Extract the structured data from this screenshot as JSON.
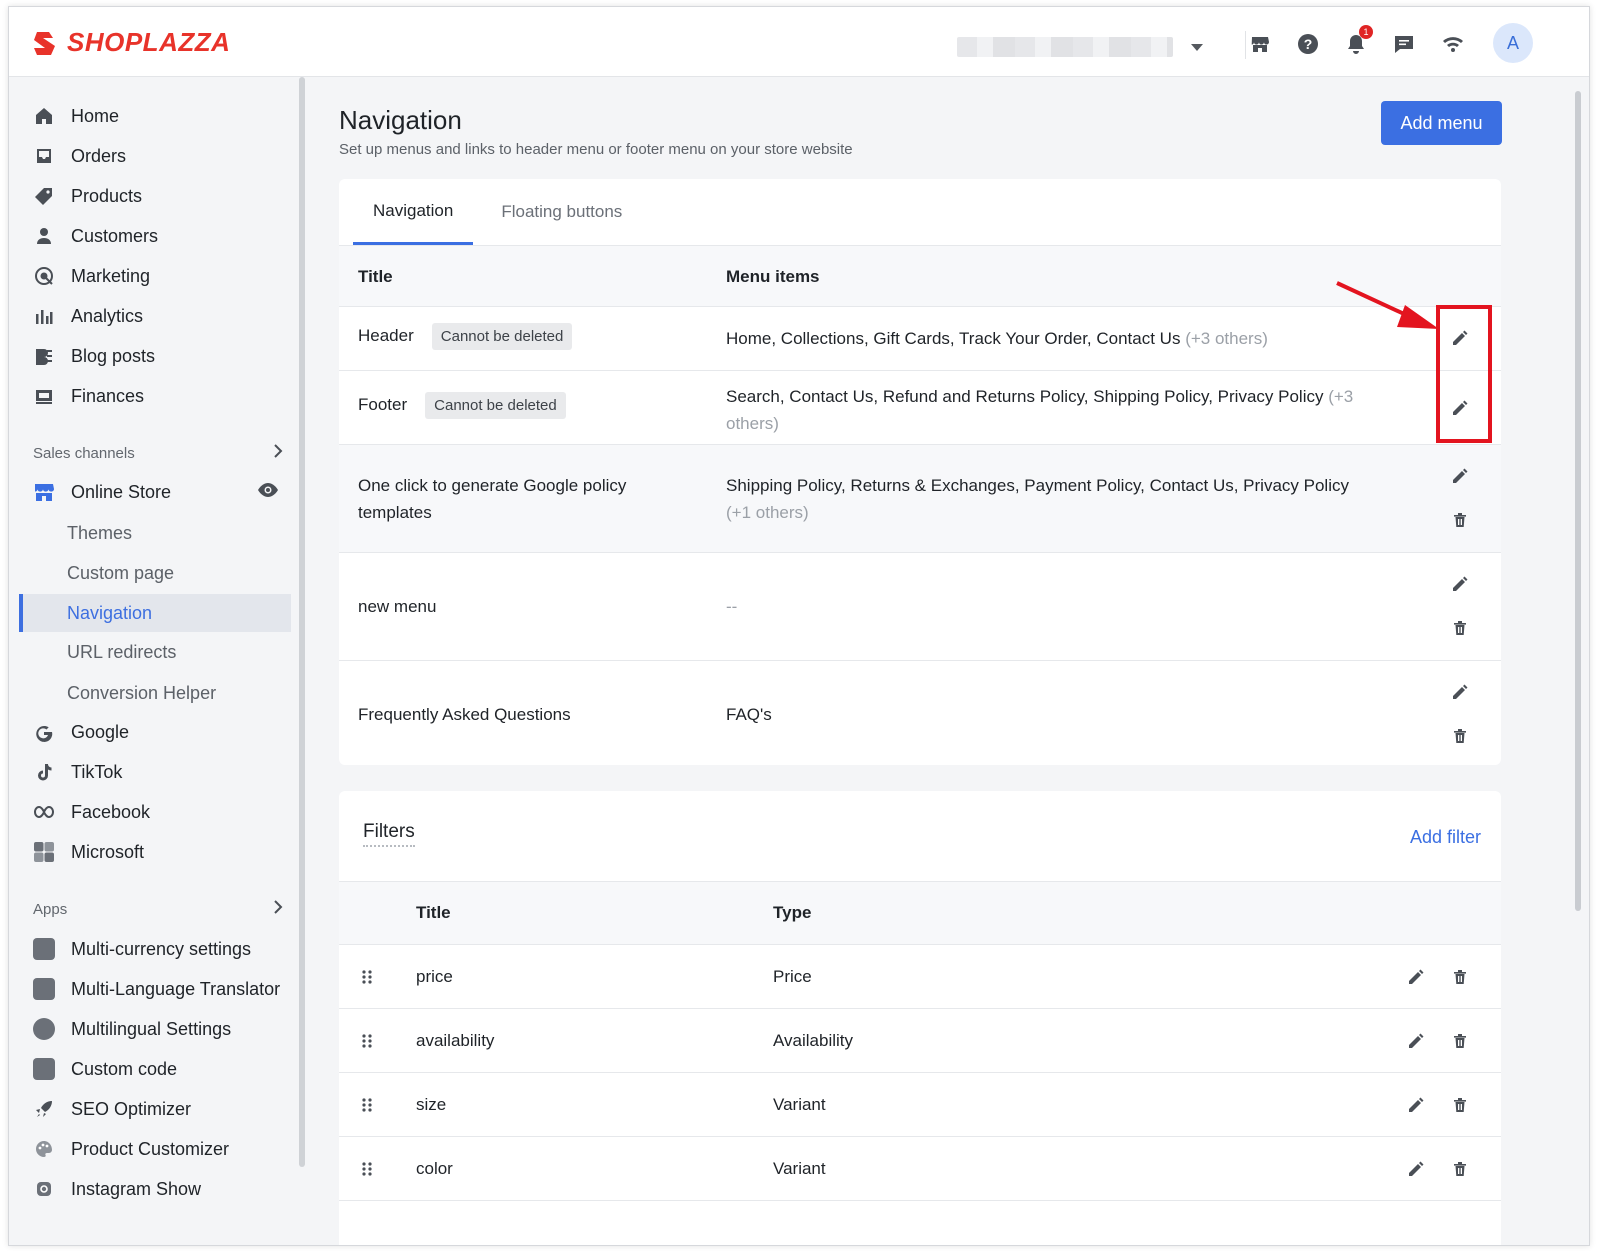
{
  "topbar": {
    "brand": "SHOPLAZZA",
    "notification_count": "1",
    "avatar_initial": "A"
  },
  "sidebar": {
    "main_items": [
      {
        "label": "Home",
        "icon": "home-icon"
      },
      {
        "label": "Orders",
        "icon": "orders-icon"
      },
      {
        "label": "Products",
        "icon": "tag-icon"
      },
      {
        "label": "Customers",
        "icon": "person-icon"
      },
      {
        "label": "Marketing",
        "icon": "target-icon"
      },
      {
        "label": "Analytics",
        "icon": "bar-chart-icon"
      },
      {
        "label": "Blog posts",
        "icon": "blog-icon"
      },
      {
        "label": "Finances",
        "icon": "finance-icon"
      }
    ],
    "sales_channels_label": "Sales channels",
    "online_store_label": "Online Store",
    "online_store_sub": [
      "Themes",
      "Custom page",
      "Navigation",
      "URL redirects",
      "Conversion Helper"
    ],
    "channels": [
      {
        "label": "Google",
        "icon": "google-icon"
      },
      {
        "label": "TikTok",
        "icon": "tiktok-icon"
      },
      {
        "label": "Facebook",
        "icon": "meta-icon"
      },
      {
        "label": "Microsoft",
        "icon": "microsoft-icon"
      }
    ],
    "apps_label": "Apps",
    "apps": [
      {
        "label": "Multi-currency settings",
        "icon": "currency-icon"
      },
      {
        "label": "Multi-Language Translator",
        "icon": "translate-icon"
      },
      {
        "label": "Multilingual Settings",
        "icon": "language-icon"
      },
      {
        "label": "Custom code",
        "icon": "code-icon"
      },
      {
        "label": "SEO Optimizer",
        "icon": "rocket-icon"
      },
      {
        "label": "Product Customizer",
        "icon": "palette-icon"
      },
      {
        "label": "Instagram Show",
        "icon": "instagram-icon"
      }
    ]
  },
  "page": {
    "title": "Navigation",
    "subtitle": "Set up menus and links to header menu or footer menu on your store website",
    "add_menu_label": "Add menu"
  },
  "tabs": [
    "Navigation",
    "Floating buttons"
  ],
  "menus_table": {
    "col_title": "Title",
    "col_items": "Menu items",
    "rows": [
      {
        "title": "Header",
        "tag": "Cannot be deleted",
        "items": "Home, Collections, Gift Cards, Track Your Order, Contact Us",
        "more": "(+3 others)"
      },
      {
        "title": "Footer",
        "tag": "Cannot be deleted",
        "items": "Search, Contact Us, Refund and Returns Policy, Shipping Policy, Privacy Policy",
        "more": "(+3 others)"
      },
      {
        "title": "One click to generate Google policy templates",
        "tag": "",
        "items": "Shipping Policy, Returns & Exchanges, Payment Policy, Contact Us, Privacy Policy",
        "more": "(+1 others)"
      },
      {
        "title": "new menu",
        "tag": "",
        "items": "--",
        "more": ""
      },
      {
        "title": "Frequently Asked Questions",
        "tag": "",
        "items": "FAQ's",
        "more": ""
      }
    ]
  },
  "filters": {
    "title": "Filters",
    "add_label": "Add filter",
    "col_title": "Title",
    "col_type": "Type",
    "rows": [
      {
        "title": "price",
        "type": "Price"
      },
      {
        "title": "availability",
        "type": "Availability"
      },
      {
        "title": "size",
        "type": "Variant"
      },
      {
        "title": "color",
        "type": "Variant"
      }
    ]
  },
  "colors": {
    "accent": "#3b6fe2",
    "brand": "#e8332a",
    "annotation": "#e3141f"
  }
}
